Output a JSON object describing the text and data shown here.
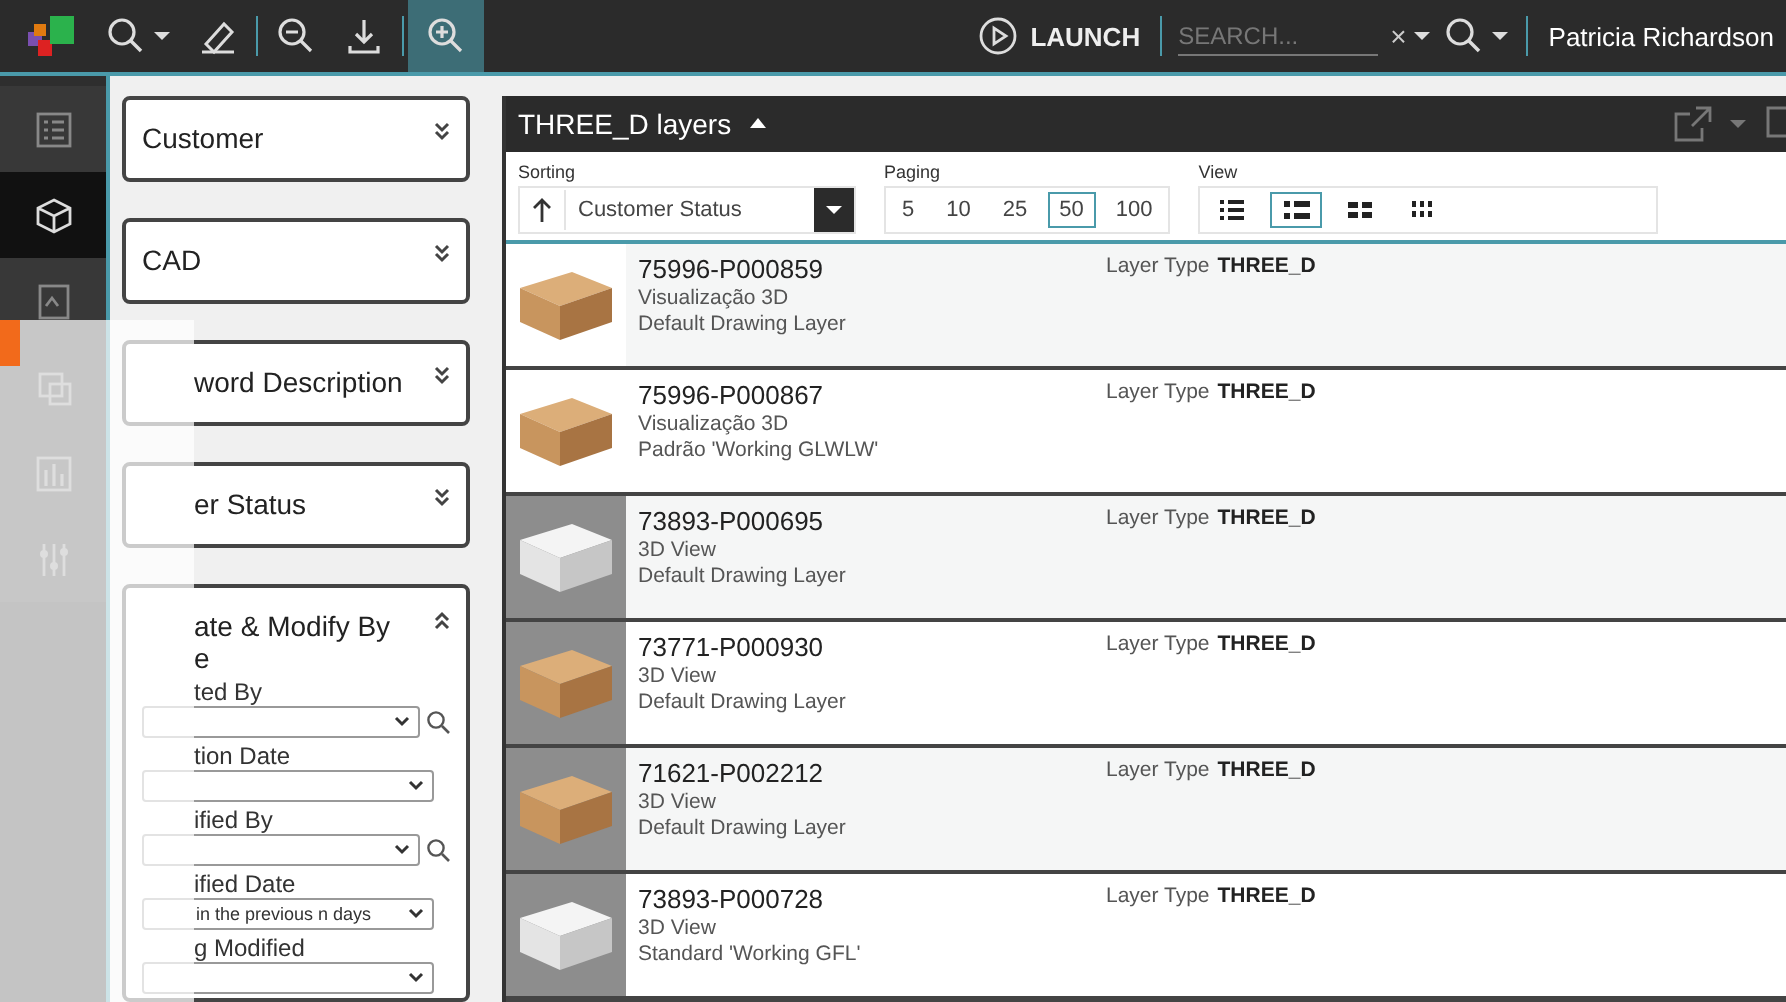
{
  "toolbar": {
    "tools": [
      {
        "kind": "search",
        "caret": true,
        "selected": false
      },
      {
        "kind": "eraser",
        "selected": false
      },
      {
        "kind": "zoom-out",
        "selected": false
      },
      {
        "kind": "download",
        "selected": false
      },
      {
        "kind": "zoom-in",
        "selected": true
      }
    ],
    "launch": "LAUNCH",
    "search": {
      "placeholder": "SEARCH..."
    },
    "clear": "×",
    "user": "Patricia Richardson"
  },
  "rail": {
    "items": [
      {
        "kind": "list",
        "selected": false
      },
      {
        "kind": "cube",
        "selected": true
      },
      {
        "kind": "image",
        "selected": false
      },
      {
        "kind": "copy"
      },
      {
        "kind": "chart"
      },
      {
        "kind": "sliders"
      }
    ]
  },
  "filters": [
    {
      "title": "Customer",
      "expanded": false,
      "partly_hidden": false
    },
    {
      "title": "CAD",
      "expanded": false,
      "partly_hidden": false
    },
    {
      "title": "word Description",
      "expanded": false,
      "partly_hidden": true
    },
    {
      "title": "er Status",
      "expanded": false,
      "partly_hidden": true
    },
    {
      "title": "ate & Modify By",
      "subtitle": "e",
      "expanded": true,
      "partly_hidden": true,
      "fields": [
        {
          "label": "ted By",
          "search": true
        },
        {
          "label": "tion Date",
          "search": false
        },
        {
          "label": "ified By",
          "search": true
        },
        {
          "label": "ified Date",
          "search": false,
          "value": "in the previous n days"
        },
        {
          "label": "g Modified",
          "search": false
        }
      ]
    }
  ],
  "layers": {
    "title": "THREE_D layers",
    "expanded": true,
    "sorting": {
      "label": "Sorting",
      "value": "Customer Status"
    },
    "paging": {
      "label": "Paging",
      "options": [
        {
          "label": "5",
          "selected": false
        },
        {
          "label": "10",
          "selected": false
        },
        {
          "label": "25",
          "selected": false
        },
        {
          "label": "50",
          "selected": true
        },
        {
          "label": "100",
          "selected": false
        }
      ]
    },
    "view": {
      "label": "View",
      "options": [
        {
          "kind": "list-compact",
          "selected": false
        },
        {
          "kind": "list",
          "selected": true
        },
        {
          "kind": "grid-large",
          "selected": false
        },
        {
          "kind": "grid-small",
          "selected": false
        }
      ]
    },
    "rows": [
      {
        "name": "75996-P000859",
        "view": "Visualização 3D",
        "layer": "Default Drawing Layer",
        "type_label": "Layer Type",
        "type": "THREE_D",
        "kind": "tan"
      },
      {
        "name": "75996-P000867",
        "view": "Visualização 3D",
        "layer": "Padrão 'Working GLWLW'",
        "type_label": "Layer Type",
        "type": "THREE_D",
        "kind": "tan"
      },
      {
        "name": "73893-P000695",
        "view": "3D View",
        "layer": "Default Drawing Layer",
        "type_label": "Layer Type",
        "type": "THREE_D",
        "kind": "white"
      },
      {
        "name": "73771-P000930",
        "view": "3D View",
        "layer": "Default Drawing Layer",
        "type_label": "Layer Type",
        "type": "THREE_D",
        "kind": "tan"
      },
      {
        "name": "71621-P002212",
        "view": "3D View",
        "layer": "Default Drawing Layer",
        "type_label": "Layer Type",
        "type": "THREE_D",
        "kind": "tan"
      },
      {
        "name": "73893-P000728",
        "view": "3D View",
        "layer": "Standard 'Working GFL'",
        "type_label": "Layer Type",
        "type": "THREE_D",
        "kind": "white"
      }
    ]
  }
}
